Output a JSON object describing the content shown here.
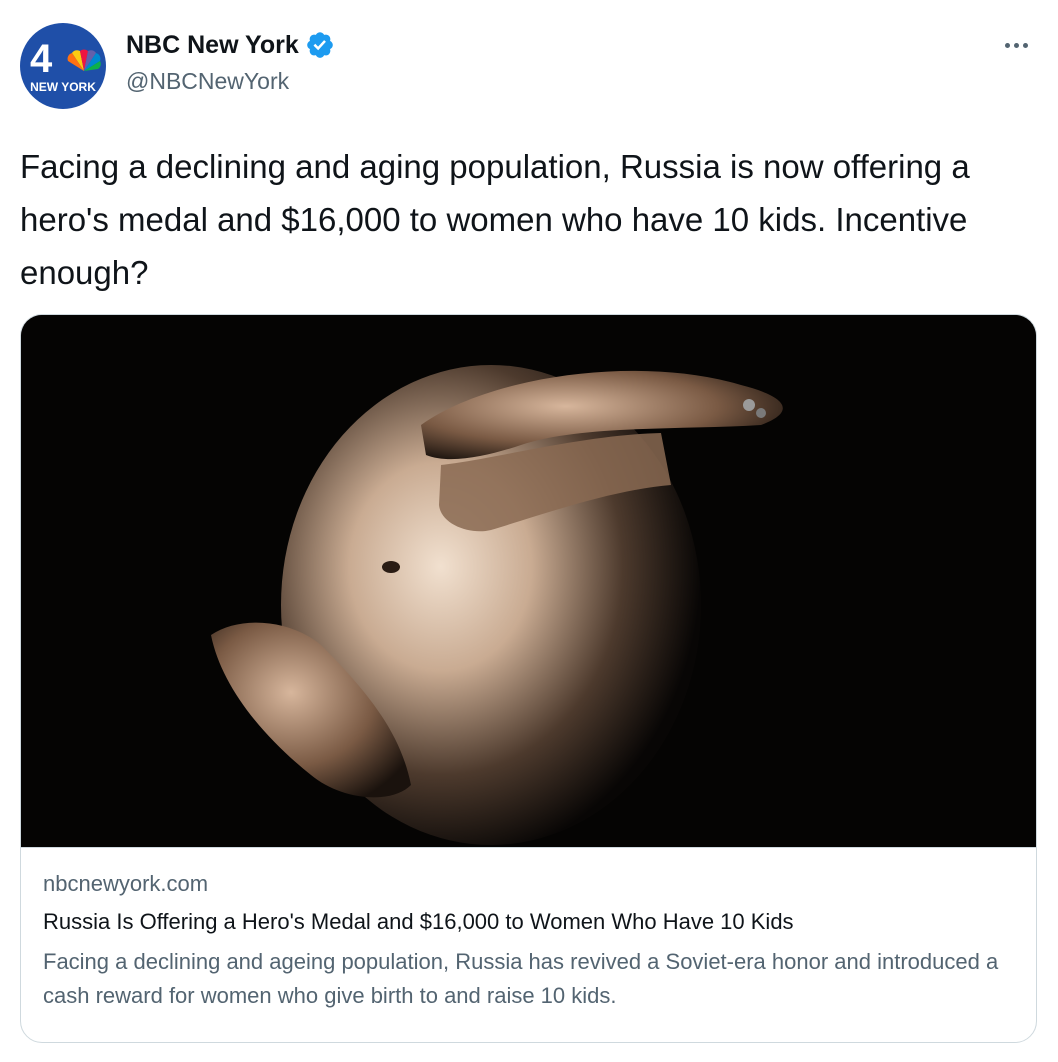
{
  "author": {
    "display_name": "NBC New York",
    "handle": "@NBCNewYork",
    "avatar": {
      "channel_number": "4",
      "caption": "NEW YORK",
      "background": "#1f4fa8"
    },
    "verified": true,
    "verified_color": "#1d9bf0"
  },
  "tweet": {
    "text": "Facing a declining and aging population, Russia is now offering a hero's medal and $16,000 to women who have 10 kids. Incentive enough?"
  },
  "link_card": {
    "domain": "nbcnewyork.com",
    "title": "Russia Is Offering a Hero's Medal and $16,000 to Women Who Have 10 Kids",
    "description": "Facing a declining and ageing population, Russia has revived a Soviet-era honor and introduced a cash reward for women who give birth to and raise 10 kids."
  },
  "icons": {
    "more": "more-horizontal-icon",
    "verified": "verified-badge-icon"
  }
}
